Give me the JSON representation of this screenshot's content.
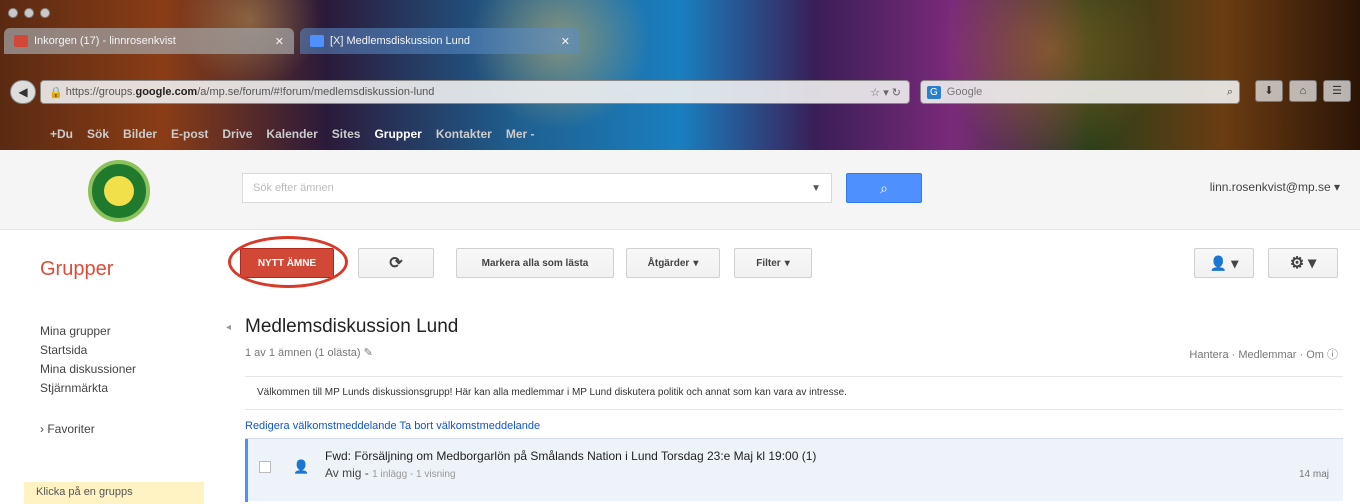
{
  "browser": {
    "tabs": [
      {
        "label": "Inkorgen (17) - linnrosenkvist",
        "favicon_color": "#d14836"
      },
      {
        "label": "[X] Medlemsdiskussion Lund",
        "favicon_color": "#4d90fe"
      }
    ],
    "url_prefix": "https://groups.",
    "url_domain": "google.com",
    "url_rest": "/a/mp.se/forum/#!forum/medlemsdiskussion-lund",
    "search_engine": "G",
    "search_placeholder": "Google"
  },
  "gbar": {
    "items": [
      "+Du",
      "Sök",
      "Bilder",
      "E-post",
      "Drive",
      "Kalender",
      "Sites",
      "Grupper",
      "Kontakter",
      "Mer -"
    ],
    "active": "Grupper"
  },
  "header": {
    "search_placeholder": "Sök efter ämnen",
    "search_icon": "magnifier-icon",
    "account": "linn.rosenkvist@mp.se"
  },
  "toolbar": {
    "app_title": "Grupper",
    "new_topic": "NYTT ÄMNE",
    "refresh_icon": "refresh-icon",
    "mark_all_read": "Markera alla som lästa",
    "actions": "Åtgärder",
    "filter": "Filter"
  },
  "sidebar": {
    "items": [
      "Mina grupper",
      "Startsida",
      "Mina diskussioner",
      "Stjärnmärkta"
    ],
    "favorites": "Favoriter",
    "favorites_hint": "Klicka på en grupps"
  },
  "forum": {
    "title": "Medlemsdiskussion Lund",
    "range": "1 av 1 ämnen (1 olästa)",
    "nav": [
      "Hantera",
      "Medlemmar",
      "Om"
    ],
    "welcome": "Välkommen till MP Lunds diskussionsgrupp! Här kan alla medlemmar i MP Lund diskutera politik och annat som kan vara av intresse.",
    "edit_welcome": "Redigera välkomstmeddelande",
    "remove_welcome": "Ta bort välkomstmeddelande"
  },
  "topics": [
    {
      "subject": "Fwd: Försäljning om Medborgarlön på Smålands Nation i Lund Torsdag 23:e Maj kl 19:00  (1)",
      "author": "Av mig",
      "stats": "1 inlägg - 1 visning",
      "date": "14 maj"
    }
  ],
  "colors": {
    "accent_red": "#dd4b39",
    "google_blue": "#4d90fe",
    "link_blue": "#1155cc",
    "annotation_circle": "#d83a2a"
  }
}
